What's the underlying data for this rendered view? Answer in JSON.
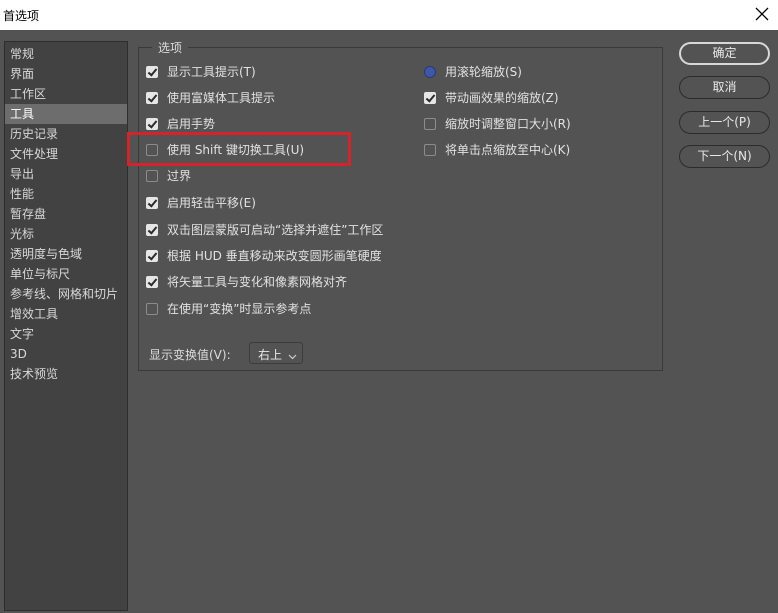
{
  "window": {
    "title": "首选项"
  },
  "sidebar": {
    "items": [
      {
        "label": "常规"
      },
      {
        "label": "界面"
      },
      {
        "label": "工作区"
      },
      {
        "label": "工具",
        "selected": true
      },
      {
        "label": "历史记录"
      },
      {
        "label": "文件处理"
      },
      {
        "label": "导出"
      },
      {
        "label": "性能"
      },
      {
        "label": "暂存盘"
      },
      {
        "label": "光标"
      },
      {
        "label": "透明度与色域"
      },
      {
        "label": "单位与标尺"
      },
      {
        "label": "参考线、网格和切片"
      },
      {
        "label": "增效工具"
      },
      {
        "label": "文字"
      },
      {
        "label": "3D"
      },
      {
        "label": "技术预览"
      }
    ]
  },
  "options": {
    "group_title": "选项",
    "left": [
      {
        "label": "显示工具提示(T)",
        "checked": true
      },
      {
        "label": "使用富媒体工具提示",
        "checked": true
      },
      {
        "label": "启用手势",
        "checked": true
      },
      {
        "label": "使用 Shift 键切换工具(U)",
        "checked": false
      },
      {
        "label": "过界",
        "checked": false
      },
      {
        "label": "启用轻击平移(E)",
        "checked": true
      },
      {
        "label": "双击图层蒙版可启动“选择并遮住”工作区",
        "checked": true
      },
      {
        "label": "根据 HUD 垂直移动来改变圆形画笔硬度",
        "checked": true
      },
      {
        "label": "将矢量工具与变化和像素网格对齐",
        "checked": true
      },
      {
        "label": "在使用“变换”时显示参考点",
        "checked": false
      }
    ],
    "right": [
      {
        "label": "用滚轮缩放(S)",
        "type": "radio",
        "checked": true
      },
      {
        "label": "带动画效果的缩放(Z)",
        "type": "checkbox",
        "checked": true
      },
      {
        "label": "缩放时调整窗口大小(R)",
        "type": "checkbox",
        "checked": false
      },
      {
        "label": "将单击点缩放至中心(K)",
        "type": "checkbox",
        "checked": false
      }
    ],
    "transform_label": "显示变换值(V):",
    "transform_value": "右上"
  },
  "buttons": {
    "ok": "确定",
    "cancel": "取消",
    "prev": "上一个(P)",
    "next": "下一个(N)"
  },
  "colors": {
    "background": "#535353",
    "sidebar_bg": "#424242",
    "selected_item": "#6d6d6d",
    "highlight_box": "#d4232a",
    "radio_fill": "#3f57a8"
  }
}
